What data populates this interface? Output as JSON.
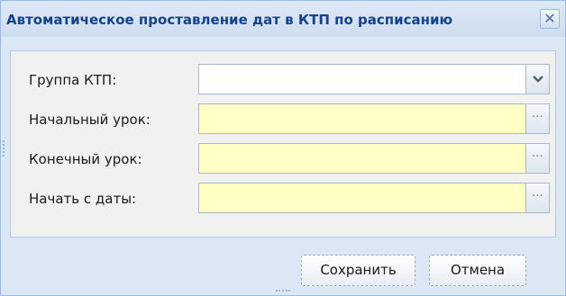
{
  "dialog": {
    "title": "Автоматическое проставление дат в КТП по расписанию",
    "close_icon": "close-icon"
  },
  "form": {
    "fields": [
      {
        "label": "Группа КТП:",
        "value": "",
        "type": "combo",
        "trigger_icon": "chevron-down-icon"
      },
      {
        "label": "Начальный урок:",
        "value": "",
        "type": "picker",
        "trigger_icon": "ellipsis-icon"
      },
      {
        "label": "Конечный урок:",
        "value": "",
        "type": "picker",
        "trigger_icon": "ellipsis-icon"
      },
      {
        "label": "Начать с даты:",
        "value": "",
        "type": "picker",
        "trigger_icon": "ellipsis-icon"
      }
    ]
  },
  "buttons": {
    "save_label": "Сохранить",
    "cancel_label": "Отмена"
  },
  "colors": {
    "window_bg": "#dbe7f5",
    "title_text": "#15428b",
    "required_field_bg": "#ffffc6"
  }
}
